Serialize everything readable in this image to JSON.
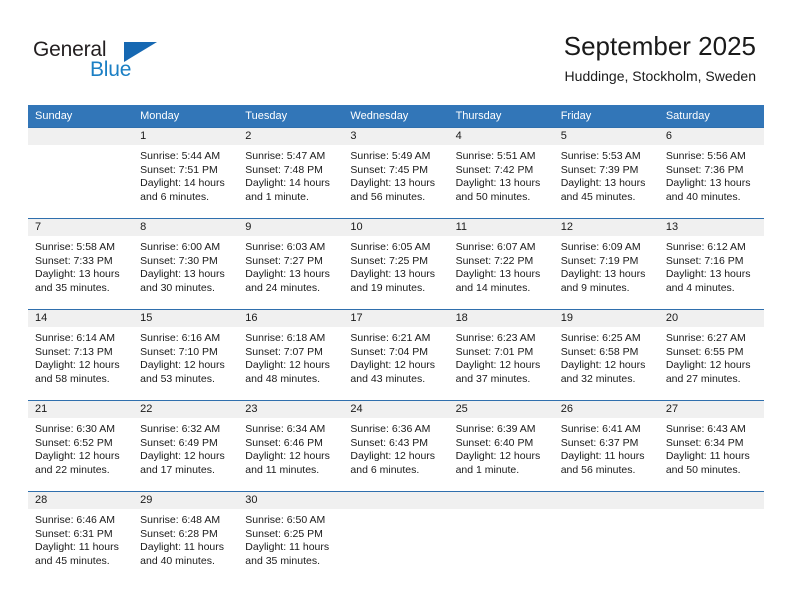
{
  "brand": {
    "name_part1": "General",
    "name_part2": "Blue",
    "triangle_color": "#1668b2",
    "blue_color": "#1b7fc4",
    "dark_color": "#231f20"
  },
  "header": {
    "title": "September 2025",
    "subtitle": "Huddinge, Stockholm, Sweden",
    "header_bg": "#3276b8",
    "band_bg": "#f0f0f0"
  },
  "weekday_headers": [
    "Sunday",
    "Monday",
    "Tuesday",
    "Wednesday",
    "Thursday",
    "Friday",
    "Saturday"
  ],
  "weeks": [
    [
      {
        "day": "",
        "sunrise": "",
        "sunset": "",
        "daylight1": "",
        "daylight2": ""
      },
      {
        "day": "1",
        "sunrise": "Sunrise: 5:44 AM",
        "sunset": "Sunset: 7:51 PM",
        "daylight1": "Daylight: 14 hours",
        "daylight2": "and 6 minutes."
      },
      {
        "day": "2",
        "sunrise": "Sunrise: 5:47 AM",
        "sunset": "Sunset: 7:48 PM",
        "daylight1": "Daylight: 14 hours",
        "daylight2": "and 1 minute."
      },
      {
        "day": "3",
        "sunrise": "Sunrise: 5:49 AM",
        "sunset": "Sunset: 7:45 PM",
        "daylight1": "Daylight: 13 hours",
        "daylight2": "and 56 minutes."
      },
      {
        "day": "4",
        "sunrise": "Sunrise: 5:51 AM",
        "sunset": "Sunset: 7:42 PM",
        "daylight1": "Daylight: 13 hours",
        "daylight2": "and 50 minutes."
      },
      {
        "day": "5",
        "sunrise": "Sunrise: 5:53 AM",
        "sunset": "Sunset: 7:39 PM",
        "daylight1": "Daylight: 13 hours",
        "daylight2": "and 45 minutes."
      },
      {
        "day": "6",
        "sunrise": "Sunrise: 5:56 AM",
        "sunset": "Sunset: 7:36 PM",
        "daylight1": "Daylight: 13 hours",
        "daylight2": "and 40 minutes."
      }
    ],
    [
      {
        "day": "7",
        "sunrise": "Sunrise: 5:58 AM",
        "sunset": "Sunset: 7:33 PM",
        "daylight1": "Daylight: 13 hours",
        "daylight2": "and 35 minutes."
      },
      {
        "day": "8",
        "sunrise": "Sunrise: 6:00 AM",
        "sunset": "Sunset: 7:30 PM",
        "daylight1": "Daylight: 13 hours",
        "daylight2": "and 30 minutes."
      },
      {
        "day": "9",
        "sunrise": "Sunrise: 6:03 AM",
        "sunset": "Sunset: 7:27 PM",
        "daylight1": "Daylight: 13 hours",
        "daylight2": "and 24 minutes."
      },
      {
        "day": "10",
        "sunrise": "Sunrise: 6:05 AM",
        "sunset": "Sunset: 7:25 PM",
        "daylight1": "Daylight: 13 hours",
        "daylight2": "and 19 minutes."
      },
      {
        "day": "11",
        "sunrise": "Sunrise: 6:07 AM",
        "sunset": "Sunset: 7:22 PM",
        "daylight1": "Daylight: 13 hours",
        "daylight2": "and 14 minutes."
      },
      {
        "day": "12",
        "sunrise": "Sunrise: 6:09 AM",
        "sunset": "Sunset: 7:19 PM",
        "daylight1": "Daylight: 13 hours",
        "daylight2": "and 9 minutes."
      },
      {
        "day": "13",
        "sunrise": "Sunrise: 6:12 AM",
        "sunset": "Sunset: 7:16 PM",
        "daylight1": "Daylight: 13 hours",
        "daylight2": "and 4 minutes."
      }
    ],
    [
      {
        "day": "14",
        "sunrise": "Sunrise: 6:14 AM",
        "sunset": "Sunset: 7:13 PM",
        "daylight1": "Daylight: 12 hours",
        "daylight2": "and 58 minutes."
      },
      {
        "day": "15",
        "sunrise": "Sunrise: 6:16 AM",
        "sunset": "Sunset: 7:10 PM",
        "daylight1": "Daylight: 12 hours",
        "daylight2": "and 53 minutes."
      },
      {
        "day": "16",
        "sunrise": "Sunrise: 6:18 AM",
        "sunset": "Sunset: 7:07 PM",
        "daylight1": "Daylight: 12 hours",
        "daylight2": "and 48 minutes."
      },
      {
        "day": "17",
        "sunrise": "Sunrise: 6:21 AM",
        "sunset": "Sunset: 7:04 PM",
        "daylight1": "Daylight: 12 hours",
        "daylight2": "and 43 minutes."
      },
      {
        "day": "18",
        "sunrise": "Sunrise: 6:23 AM",
        "sunset": "Sunset: 7:01 PM",
        "daylight1": "Daylight: 12 hours",
        "daylight2": "and 37 minutes."
      },
      {
        "day": "19",
        "sunrise": "Sunrise: 6:25 AM",
        "sunset": "Sunset: 6:58 PM",
        "daylight1": "Daylight: 12 hours",
        "daylight2": "and 32 minutes."
      },
      {
        "day": "20",
        "sunrise": "Sunrise: 6:27 AM",
        "sunset": "Sunset: 6:55 PM",
        "daylight1": "Daylight: 12 hours",
        "daylight2": "and 27 minutes."
      }
    ],
    [
      {
        "day": "21",
        "sunrise": "Sunrise: 6:30 AM",
        "sunset": "Sunset: 6:52 PM",
        "daylight1": "Daylight: 12 hours",
        "daylight2": "and 22 minutes."
      },
      {
        "day": "22",
        "sunrise": "Sunrise: 6:32 AM",
        "sunset": "Sunset: 6:49 PM",
        "daylight1": "Daylight: 12 hours",
        "daylight2": "and 17 minutes."
      },
      {
        "day": "23",
        "sunrise": "Sunrise: 6:34 AM",
        "sunset": "Sunset: 6:46 PM",
        "daylight1": "Daylight: 12 hours",
        "daylight2": "and 11 minutes."
      },
      {
        "day": "24",
        "sunrise": "Sunrise: 6:36 AM",
        "sunset": "Sunset: 6:43 PM",
        "daylight1": "Daylight: 12 hours",
        "daylight2": "and 6 minutes."
      },
      {
        "day": "25",
        "sunrise": "Sunrise: 6:39 AM",
        "sunset": "Sunset: 6:40 PM",
        "daylight1": "Daylight: 12 hours",
        "daylight2": "and 1 minute."
      },
      {
        "day": "26",
        "sunrise": "Sunrise: 6:41 AM",
        "sunset": "Sunset: 6:37 PM",
        "daylight1": "Daylight: 11 hours",
        "daylight2": "and 56 minutes."
      },
      {
        "day": "27",
        "sunrise": "Sunrise: 6:43 AM",
        "sunset": "Sunset: 6:34 PM",
        "daylight1": "Daylight: 11 hours",
        "daylight2": "and 50 minutes."
      }
    ],
    [
      {
        "day": "28",
        "sunrise": "Sunrise: 6:46 AM",
        "sunset": "Sunset: 6:31 PM",
        "daylight1": "Daylight: 11 hours",
        "daylight2": "and 45 minutes."
      },
      {
        "day": "29",
        "sunrise": "Sunrise: 6:48 AM",
        "sunset": "Sunset: 6:28 PM",
        "daylight1": "Daylight: 11 hours",
        "daylight2": "and 40 minutes."
      },
      {
        "day": "30",
        "sunrise": "Sunrise: 6:50 AM",
        "sunset": "Sunset: 6:25 PM",
        "daylight1": "Daylight: 11 hours",
        "daylight2": "and 35 minutes."
      },
      {
        "day": "",
        "sunrise": "",
        "sunset": "",
        "daylight1": "",
        "daylight2": ""
      },
      {
        "day": "",
        "sunrise": "",
        "sunset": "",
        "daylight1": "",
        "daylight2": ""
      },
      {
        "day": "",
        "sunrise": "",
        "sunset": "",
        "daylight1": "",
        "daylight2": ""
      },
      {
        "day": "",
        "sunrise": "",
        "sunset": "",
        "daylight1": "",
        "daylight2": ""
      }
    ]
  ]
}
